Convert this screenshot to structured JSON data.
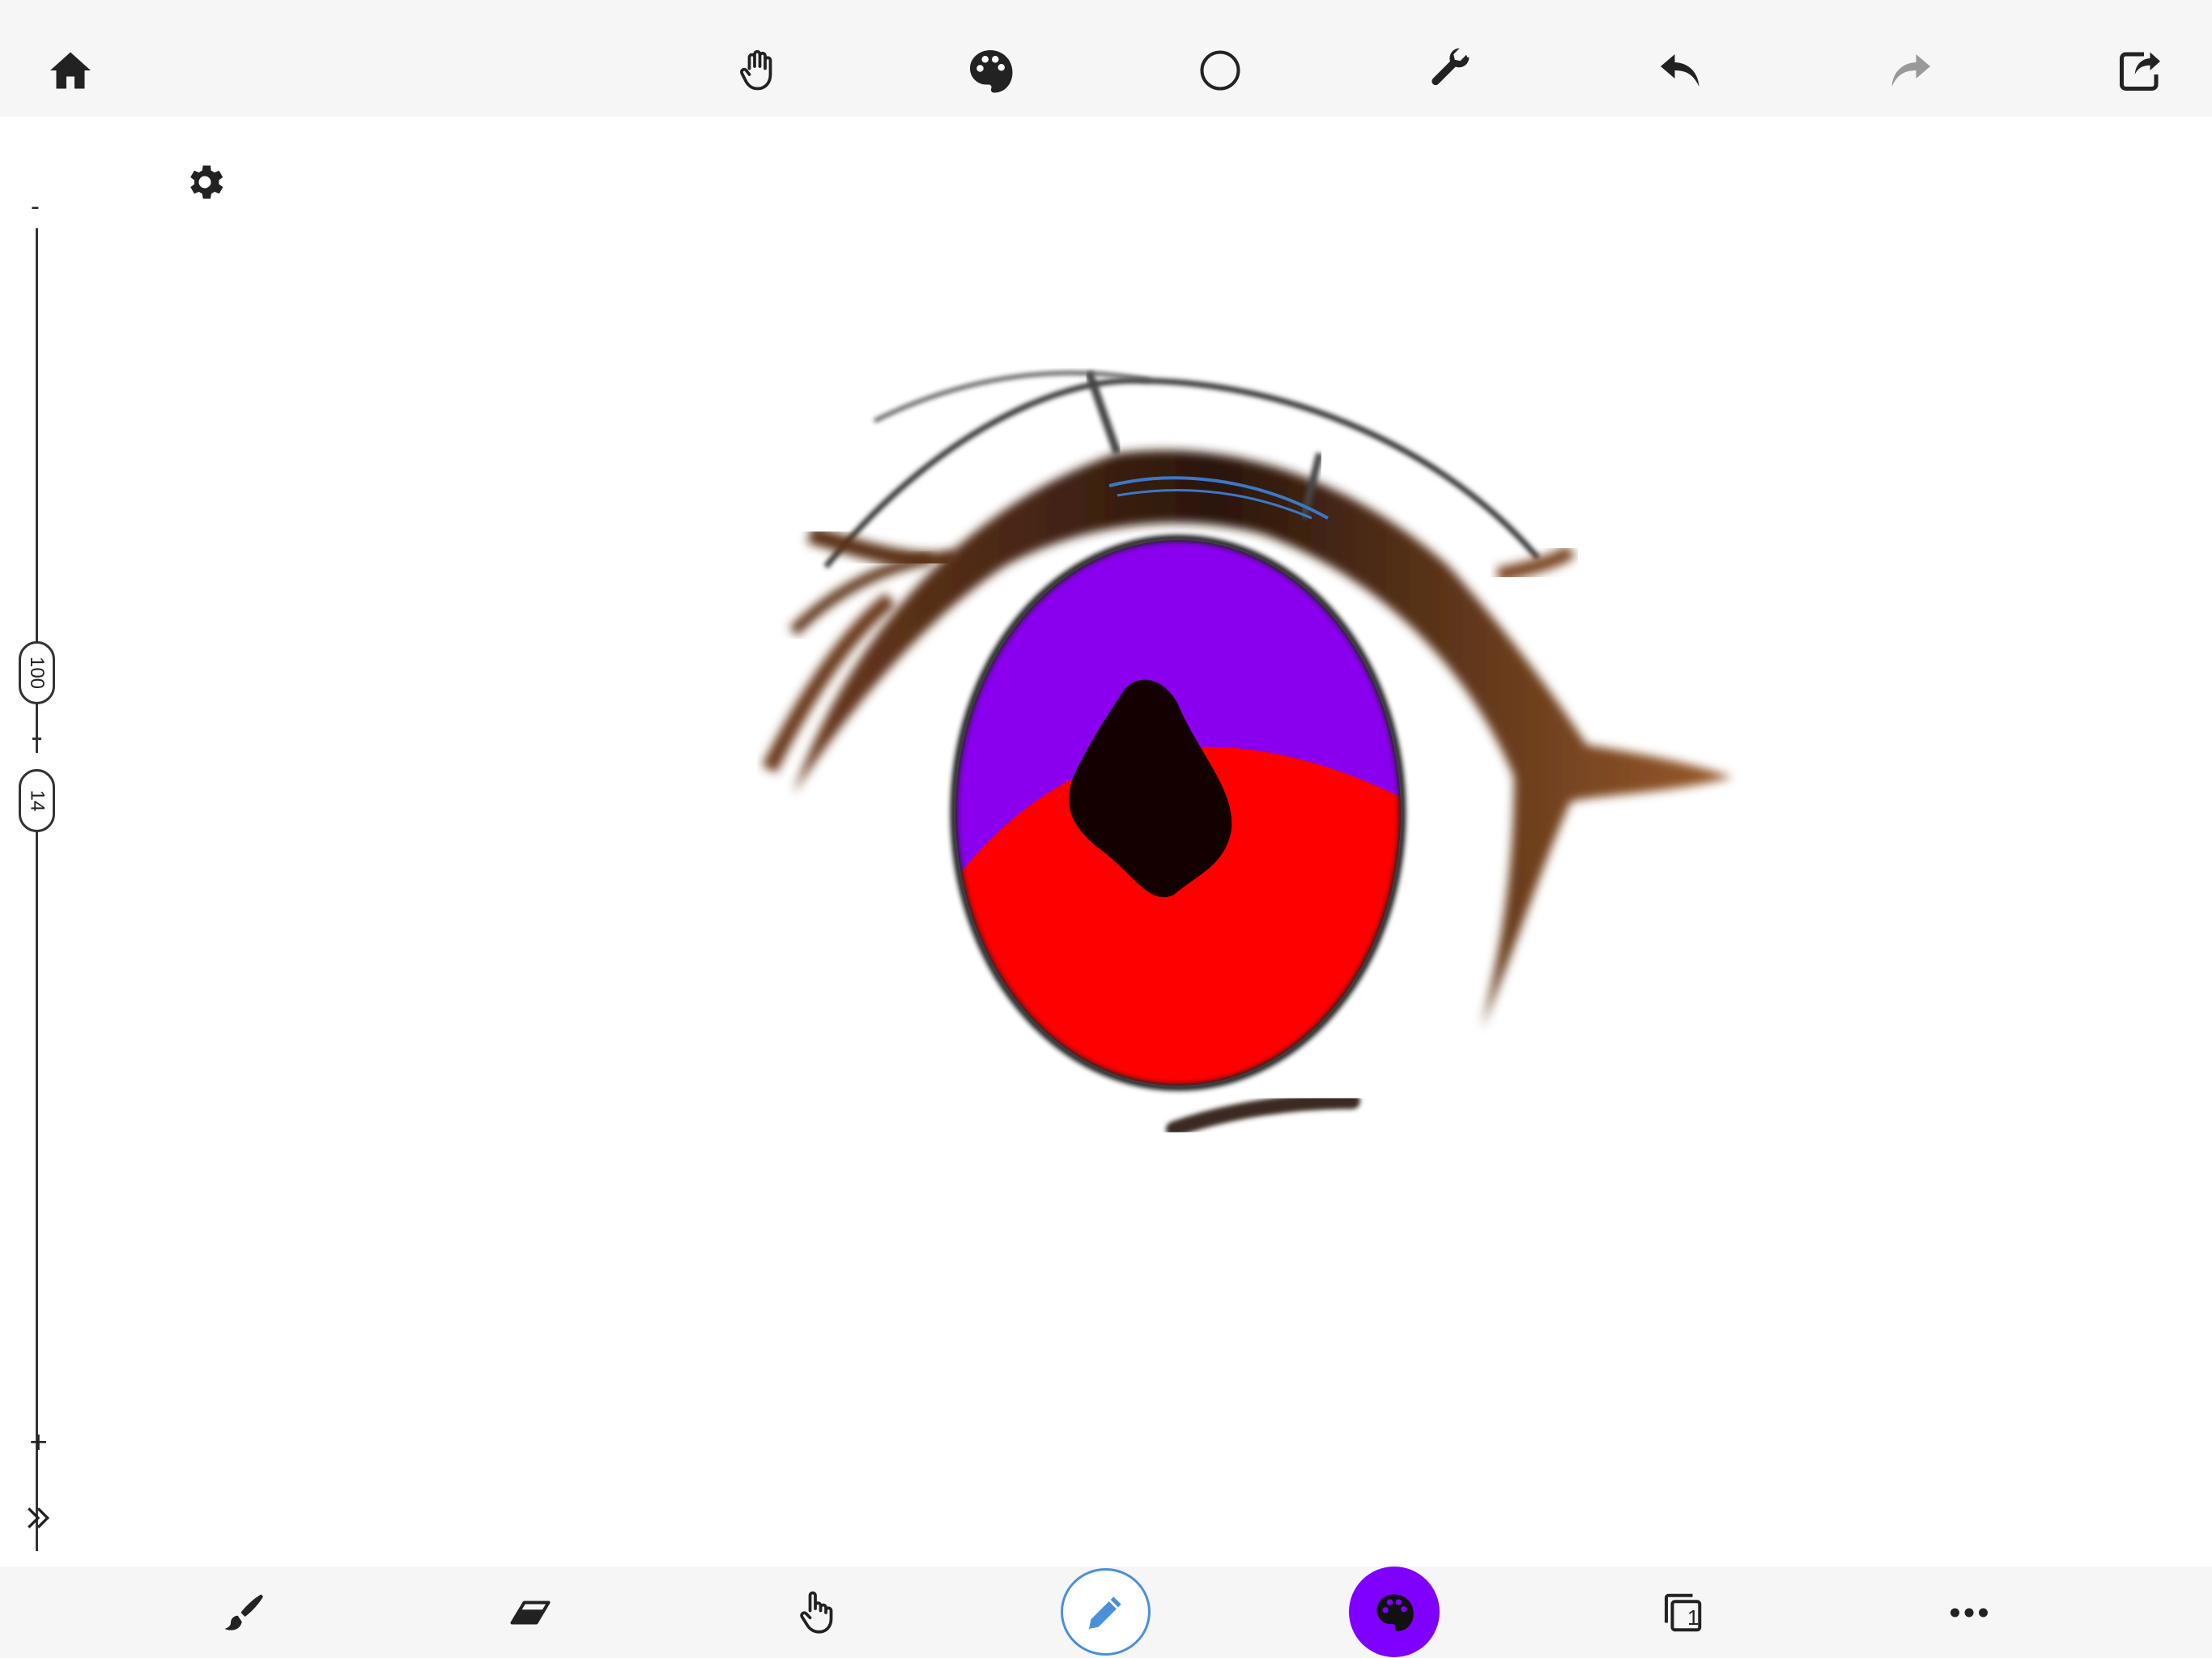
{
  "toolbar_top": {
    "icons": [
      "home-icon",
      "hand-icon",
      "palette-icon",
      "circle-icon",
      "wrench-icon",
      "undo-icon",
      "redo-icon",
      "share-icon"
    ]
  },
  "left_panel": {
    "settings_icon": "gear-icon",
    "size_slider": {
      "minus": "-",
      "plus": "+",
      "opacity_value": "100",
      "size_value": "14"
    },
    "expand_icon": "double-chevron-right-icon"
  },
  "toolbar_bottom": {
    "icons": [
      "brush-icon",
      "eraser-icon",
      "finger-icon",
      "pencil-icon",
      "palette-icon",
      "layers-icon",
      "more-icon"
    ],
    "layers_count": "1",
    "active_color": "#8000ff",
    "pencil_ring_color": "#4a90d9"
  },
  "drawing": {
    "iris_top_color": "#8a00ee",
    "iris_bottom_color": "#ff0000",
    "pupil_color": "#150000",
    "lash_color": "#6b3a1e"
  }
}
